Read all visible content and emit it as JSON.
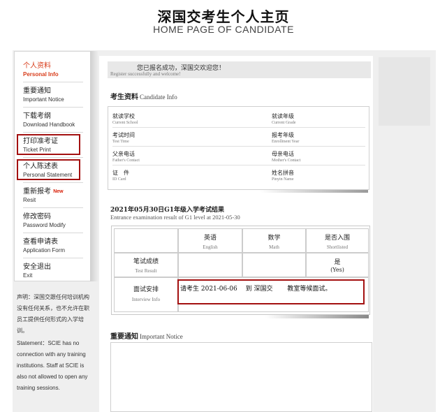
{
  "header": {
    "title": "深国交考生个人主页",
    "subtitle": "HOME PAGE OF CANDIDATE"
  },
  "sidebar": {
    "items": [
      {
        "cn": "个人资料",
        "en": "Personal Info",
        "active": true
      },
      {
        "cn": "重要通知",
        "en": "Important Notice"
      },
      {
        "cn": "下载考纲",
        "en": "Download Handbook"
      },
      {
        "cn": "打印准考证",
        "en": "Ticket Print"
      },
      {
        "cn": "个人陈述表",
        "en": "Personal Statement"
      },
      {
        "cn": "重新报考",
        "en": "Resit",
        "tag": "New"
      },
      {
        "cn": "修改密码",
        "en": "Password Modify"
      },
      {
        "cn": "查看申请表",
        "en": "Application Form"
      },
      {
        "cn": "安全退出",
        "en": "Exit"
      }
    ],
    "note_cn": "声明：深国交跟任何培训机构没有任何关系，也不允许在职员工提供任何形式的入学培训。",
    "note_en": "Statement：SCIE has no connection with any training institutions. Staff at SCIE is also not allowed to open any training sessions."
  },
  "welcome": {
    "cn": "您已报名成功，深国交欢迎您！",
    "en": "Register successfully and welcome!"
  },
  "candidate_info": {
    "title_cn": "考生资料",
    "title_en": "Candidate Info",
    "fields": [
      {
        "cn": "就读学校",
        "en": "Current School"
      },
      {
        "cn": "就读年级",
        "en": "Current Grade"
      },
      {
        "cn": "考试时间",
        "en": "Test Time"
      },
      {
        "cn": "报考年级",
        "en": "Enrollment Year"
      },
      {
        "cn": "父亲电话",
        "en": "Father's Contact"
      },
      {
        "cn": "母亲电话",
        "en": "Mother's Contact"
      },
      {
        "cn": "证　件",
        "en": "ID Card"
      },
      {
        "cn": "姓名拼音",
        "en": "Pinyin Name"
      }
    ]
  },
  "results": {
    "title": "2021年05月30日G1年级入学考试结果",
    "subtitle": "Entrance examination result of G1 level at 2021-05-30",
    "columns": [
      {
        "cn": "英语",
        "en": "English"
      },
      {
        "cn": "数学",
        "en": "Math"
      },
      {
        "cn": "是否入围",
        "en": "Shortlisted"
      }
    ],
    "rows": {
      "written": {
        "cn": "笔试成绩",
        "en": "Test Result",
        "shortlisted_cn": "是",
        "shortlisted_en": "(Yes)"
      },
      "interview": {
        "cn": "面试安排",
        "en": "Interview Info",
        "text": "请考生 2021-06-06　 到 深国交　　 教室等候面试。"
      }
    }
  },
  "notice": {
    "title_cn": "重要通知",
    "title_en": "Important Notice"
  },
  "colors": {
    "accent": "#d83c1a",
    "highlight_border": "#a31010"
  }
}
